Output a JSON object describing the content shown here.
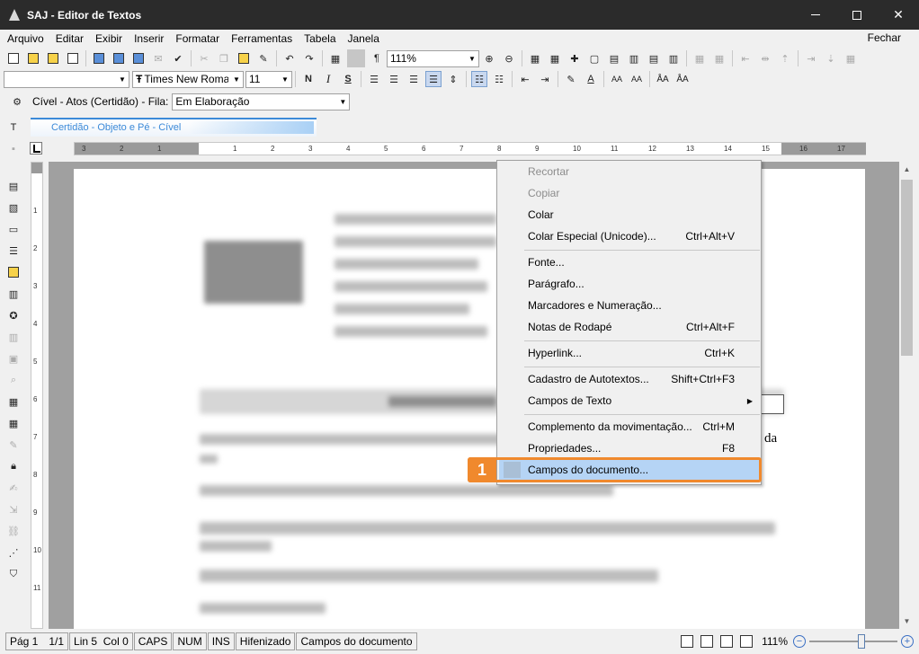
{
  "window": {
    "title": "SAJ - Editor de Textos"
  },
  "menu": {
    "items": [
      {
        "label": "Arquivo"
      },
      {
        "label": "Editar"
      },
      {
        "label": "Exibir"
      },
      {
        "label": "Inserir"
      },
      {
        "label": "Formatar"
      },
      {
        "label": "Ferramentas"
      },
      {
        "label": "Tabela"
      },
      {
        "label": "Janela"
      }
    ],
    "close_label": "Fechar"
  },
  "toolbar": {
    "zoom_value": "111%",
    "font_name": "Times New Roman",
    "font_size": "11",
    "bold_label": "N",
    "italic_label": "I",
    "underline_label": "S",
    "pilcrow": "¶"
  },
  "fila": {
    "label": "Cível - Atos (Certidão) - Fila:",
    "value": "Em Elaboração"
  },
  "document_tab": {
    "label": "Certidão - Objeto e Pé - Cível"
  },
  "page": {
    "visible_text_fragment": "da"
  },
  "context_menu": {
    "items": [
      {
        "label": "Recortar",
        "shortcut": "",
        "disabled": true
      },
      {
        "label": "Copiar",
        "shortcut": "",
        "disabled": true
      },
      {
        "label": "Colar",
        "shortcut": ""
      },
      {
        "label": "Colar Especial (Unicode)...",
        "shortcut": "Ctrl+Alt+V"
      },
      {
        "label": "Fonte...",
        "shortcut": ""
      },
      {
        "label": "Parágrafo...",
        "shortcut": ""
      },
      {
        "label": "Marcadores e Numeração...",
        "shortcut": ""
      },
      {
        "label": "Notas de Rodapé",
        "shortcut": "Ctrl+Alt+F"
      },
      {
        "label": "Hyperlink...",
        "shortcut": "Ctrl+K"
      },
      {
        "label": "Cadastro de Autotextos...",
        "shortcut": "Shift+Ctrl+F3"
      },
      {
        "label": "Campos de Texto",
        "shortcut": "",
        "submenu": true
      },
      {
        "label": "Complemento da movimentação...",
        "shortcut": "Ctrl+M"
      },
      {
        "label": "Propriedades...",
        "shortcut": "F8"
      },
      {
        "label": "Campos do documento...",
        "shortcut": "",
        "highlighted": true
      }
    ]
  },
  "callout": {
    "number": "1",
    "color": "#f0892d"
  },
  "statusbar": {
    "page_label": "Pág 1",
    "page_count": "1/1",
    "line_col": "Lin 5  Col 0",
    "caps": "CAPS",
    "num": "NUM",
    "ins": "INS",
    "hyphen": "Hifenizado",
    "context": "Campos do documento",
    "zoom": "111%",
    "zoom_fraction": 0.6
  },
  "colors": {
    "accent_tab": "#3c8ad8",
    "highlight": "#b5d4f5",
    "titlebar": "#2b2b2b"
  }
}
